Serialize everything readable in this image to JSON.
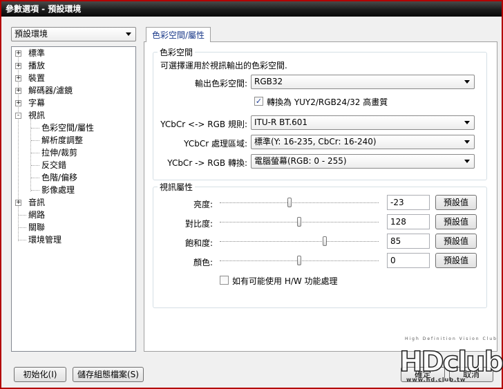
{
  "window": {
    "title": "參數選項 - 預設環境"
  },
  "profile_select": {
    "value": "預設環境"
  },
  "tree": {
    "items": [
      {
        "label": "標準",
        "expander": "+"
      },
      {
        "label": "播放",
        "expander": "+"
      },
      {
        "label": "裝置",
        "expander": "+"
      },
      {
        "label": "解碼器/濾鏡",
        "expander": "+"
      },
      {
        "label": "字幕",
        "expander": "+"
      },
      {
        "label": "視訊",
        "expander": "-"
      },
      {
        "label": "色彩空間/屬性"
      },
      {
        "label": "解析度調整"
      },
      {
        "label": "拉伸/裁剪"
      },
      {
        "label": "反交錯"
      },
      {
        "label": "色階/偏移"
      },
      {
        "label": "影像處理"
      },
      {
        "label": "音訊",
        "expander": "+"
      },
      {
        "label": "網路"
      },
      {
        "label": "關聯"
      },
      {
        "label": "環境管理"
      }
    ]
  },
  "tab": {
    "label": "色彩空間/屬性"
  },
  "colorspace": {
    "title": "色彩空間",
    "description": "可選擇運用於視訊輸出的色彩空間.",
    "output_label": "輸出色彩空間:",
    "output_value": "RGB32",
    "convert_checkbox": {
      "label": "轉換為 YUY2/RGB24/32 高畫質",
      "checked": true,
      "mark": "✓"
    },
    "rule_label": "YCbCr <-> RGB 規則:",
    "rule_value": "ITU-R BT.601",
    "range_label": "YCbCr 處理區域:",
    "range_value": "標準(Y: 16-235, CbCr: 16-240)",
    "convert_label": "YCbCr -> RGB 轉換:",
    "convert_value": "電腦螢幕(RGB: 0 - 255)"
  },
  "video_props": {
    "title": "視訊屬性",
    "rows": [
      {
        "label": "亮度:",
        "value": "-23",
        "level": 0.44,
        "button": "預設值"
      },
      {
        "label": "對比度:",
        "value": "128",
        "level": 0.5,
        "button": "預設值"
      },
      {
        "label": "飽和度:",
        "value": "85",
        "level": 0.66,
        "button": "預設值"
      },
      {
        "label": "顏色:",
        "value": "0",
        "level": 0.5,
        "button": "預設值"
      }
    ],
    "hw_checkbox": {
      "label": "如有可能使用 H/W 功能處理",
      "checked": false
    }
  },
  "footer": {
    "reset_button": "初始化(I)",
    "save_profile_button": "儲存組態檔案(S)",
    "ok_button": "確定",
    "cancel_button": "取消"
  },
  "watermark": {
    "tagline": "High Definition Vision Club",
    "logo": "HDclub",
    "url": "www.hd.club.tw"
  },
  "colors": {
    "titlebar": "#1c1c1c",
    "tab_text": "#1b3a8a",
    "window_border": "#b30000"
  }
}
